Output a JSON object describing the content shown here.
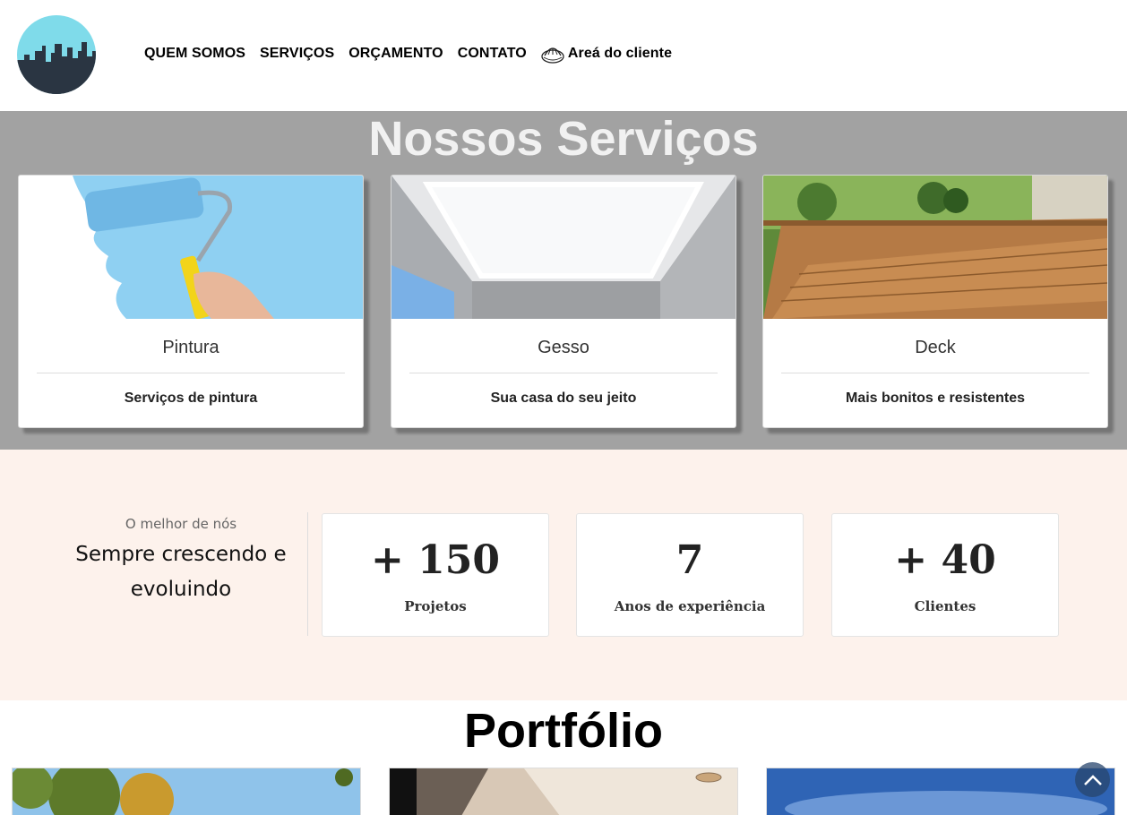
{
  "header": {
    "logo_icon": "city-skyline-logo",
    "nav": [
      {
        "label": "QUEM SOMOS"
      },
      {
        "label": "SERVIÇOS"
      },
      {
        "label": "ORÇAMENTO"
      },
      {
        "label": "CONTATO"
      }
    ],
    "client_area": {
      "icon": "dome-lock-icon",
      "label": "Areá do cliente"
    }
  },
  "services": {
    "title": "Nossos Serviços",
    "cards": [
      {
        "title": "Pintura",
        "desc": "Serviços de pintura",
        "image": "paint-roller-photo"
      },
      {
        "title": "Gesso",
        "desc": "Sua casa do seu jeito",
        "image": "plaster-ceiling-photo"
      },
      {
        "title": "Deck",
        "desc": "Mais bonitos e resistentes",
        "image": "wooden-deck-photo"
      }
    ]
  },
  "stats": {
    "eyebrow": "O melhor de nós",
    "headline": "Sempre crescendo e evoluindo",
    "items": [
      {
        "value": "+ 150",
        "label": "Projetos"
      },
      {
        "value": "7",
        "label": "Anos de experiência"
      },
      {
        "value": "+ 40",
        "label": "Clientes"
      }
    ]
  },
  "portfolio": {
    "title": "Portfólio",
    "images": [
      "trees-sky-photo",
      "interior-ceiling-photo",
      "blue-sky-photo"
    ]
  },
  "scroll_top_icon": "chevron-up-icon",
  "colors": {
    "services_bg": "#a2a2a2",
    "stats_bg": "#fdf2ec",
    "logo_sky": "#7fdbea",
    "logo_city": "#2a3542"
  }
}
